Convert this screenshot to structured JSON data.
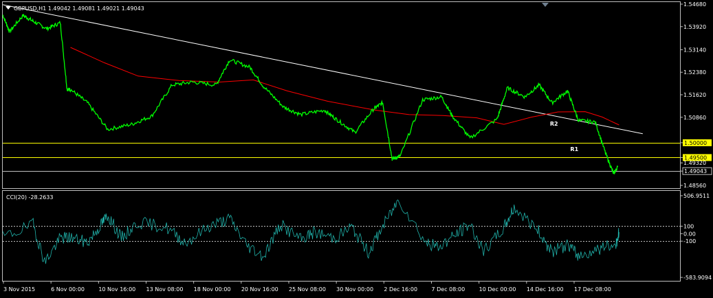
{
  "symbol_line": "GBPUSD,H1  1.49042 1.49081 1.49021 1.49043",
  "indicator_line": "CCI(20) -28.2633",
  "colors": {
    "background": "#000000",
    "frame": "#c0c0c0",
    "price": "#00ff00",
    "ma": "#ff0000",
    "trendline": "#ffffff",
    "levels": "#ffff00",
    "cci": "#20b2aa",
    "text": "#ffffff",
    "label_fill": "#ffff00",
    "label_text": "#000000",
    "current_fill": "#000000"
  },
  "chart_data": [
    {
      "type": "line",
      "symbol": "GBPUSD",
      "timeframe": "H1",
      "ohlc": {
        "open": 1.49042,
        "high": 1.49081,
        "low": 1.49021,
        "close": 1.49043
      },
      "y_ticks": [
        "1.54680",
        "1.53920",
        "1.53140",
        "1.52380",
        "1.51620",
        "1.50860",
        "1.50000",
        "1.49500",
        "1.49320",
        "1.49043",
        "1.48560"
      ],
      "x_ticks": [
        "3 Nov 2015",
        "6 Nov 00:00",
        "10 Nov 16:00",
        "13 Nov 08:00",
        "18 Nov 00:00",
        "20 Nov 16:00",
        "25 Nov 08:00",
        "30 Nov 00:00",
        "2 Dec 16:00",
        "7 Dec 08:00",
        "10 Dec 00:00",
        "14 Dec 16:00",
        "17 Dec 08:00"
      ],
      "ylim": [
        1.4856,
        1.5468
      ],
      "levels": [
        {
          "value": 1.5,
          "label": "1.50000",
          "tag": "R2"
        },
        {
          "value": 1.495,
          "label": "1.49500",
          "tag": "R1"
        },
        {
          "value": 1.49043,
          "label": "1.49043",
          "tag": ""
        }
      ],
      "trendline": [
        {
          "x": 0,
          "y": 1.5466
        },
        {
          "x": 1,
          "y": 1.5005
        }
      ],
      "series": [
        {
          "name": "GBPUSD",
          "x": [
            0,
            0.01,
            0.03,
            0.045,
            0.065,
            0.085,
            0.095,
            0.1,
            0.125,
            0.155,
            0.19,
            0.22,
            0.25,
            0.28,
            0.315,
            0.335,
            0.365,
            0.385,
            0.415,
            0.44,
            0.475,
            0.495,
            0.52,
            0.548,
            0.561,
            0.575,
            0.587,
            0.62,
            0.648,
            0.664,
            0.69,
            0.73,
            0.745,
            0.771,
            0.792,
            0.811,
            0.834,
            0.85,
            0.875,
            0.89,
            0.902,
            0.908
          ],
          "y": [
            1.5432,
            1.5375,
            1.543,
            1.541,
            1.5385,
            1.5405,
            1.518,
            1.518,
            1.5135,
            1.5045,
            1.5062,
            1.509,
            1.5195,
            1.5205,
            1.5195,
            1.528,
            1.5255,
            1.519,
            1.512,
            1.5095,
            1.511,
            1.5075,
            1.5035,
            1.5115,
            1.5135,
            1.4945,
            1.4955,
            1.5145,
            1.5155,
            1.509,
            1.5015,
            1.508,
            1.5185,
            1.5155,
            1.5195,
            1.5135,
            1.5175,
            1.5075,
            1.507,
            1.4965,
            1.4895,
            1.4918
          ]
        },
        {
          "name": "MA",
          "x": [
            0.1,
            0.15,
            0.2,
            0.26,
            0.32,
            0.37,
            0.42,
            0.48,
            0.55,
            0.6,
            0.65,
            0.7,
            0.74,
            0.78,
            0.82,
            0.86,
            0.885,
            0.91
          ],
          "y": [
            1.5322,
            1.527,
            1.5225,
            1.521,
            1.5205,
            1.5212,
            1.5175,
            1.514,
            1.511,
            1.5095,
            1.5092,
            1.5084,
            1.5062,
            1.5086,
            1.5104,
            1.5105,
            1.5087,
            1.506
          ]
        }
      ]
    },
    {
      "type": "line",
      "name": "CCI(20)",
      "current_value": -28.2633,
      "y_ticks": [
        "506.9511",
        "100",
        "0.00",
        "-100",
        "-583.9094"
      ],
      "ylim": [
        -583.9094,
        506.9511
      ],
      "levels": [
        100,
        0,
        -100
      ],
      "series": [
        {
          "name": "CCI",
          "x": [
            0,
            0.045,
            0.062,
            0.085,
            0.1,
            0.125,
            0.145,
            0.155,
            0.175,
            0.2,
            0.24,
            0.27,
            0.305,
            0.335,
            0.36,
            0.385,
            0.41,
            0.44,
            0.46,
            0.49,
            0.515,
            0.54,
            0.56,
            0.585,
            0.625,
            0.643,
            0.668,
            0.69,
            0.71,
            0.74,
            0.755,
            0.79,
            0.81,
            0.835,
            0.85,
            0.88,
            0.905,
            0.91
          ],
          "y": [
            -50,
            120,
            -380,
            -60,
            -50,
            -120,
            120,
            250,
            -60,
            150,
            90,
            -120,
            100,
            200,
            -150,
            -300,
            120,
            -80,
            20,
            -60,
            90,
            -250,
            80,
            460,
            -120,
            -180,
            -20,
            130,
            -250,
            80,
            350,
            50,
            -240,
            -150,
            -300,
            -200,
            -150,
            20
          ]
        }
      ]
    }
  ]
}
